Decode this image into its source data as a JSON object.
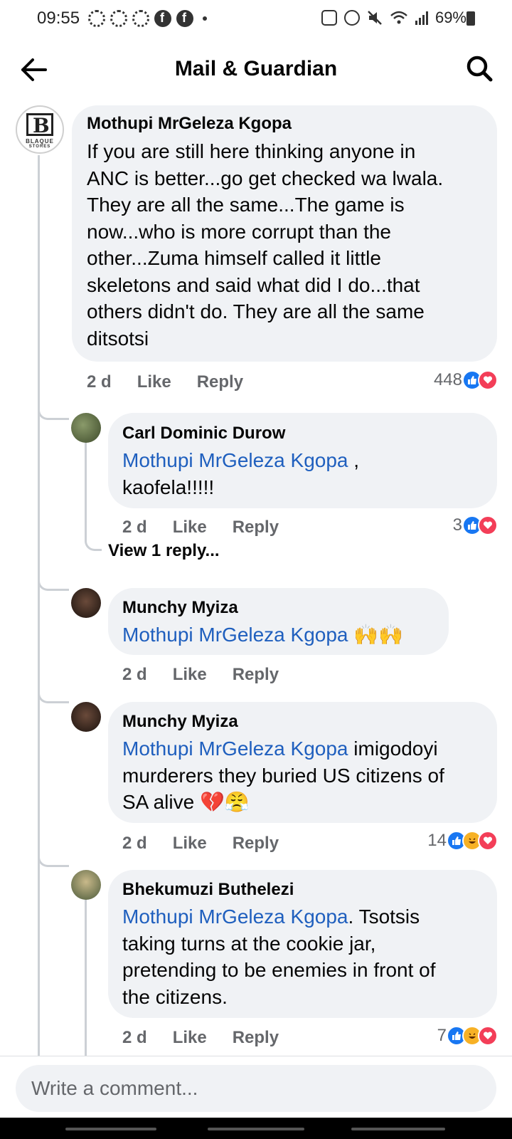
{
  "status_bar": {
    "time": "09:55",
    "battery": "69%"
  },
  "header": {
    "title": "Mail & Guardian",
    "back_icon": "arrow-left-icon",
    "search_icon": "search-icon"
  },
  "comments": [
    {
      "author": "Mothupi MrGeleza Kgopa",
      "avatar_label": "B",
      "avatar_text": "BLAQUE",
      "avatar_subtext": "STORES",
      "lines": [
        "If you are still here thinking anyone in",
        "ANC is better...go get checked wa lwala.",
        "They are all the same...The game is",
        "now...who is more corrupt than the",
        "other...Zuma himself called it little",
        "skeletons and said what did I do...that",
        "others didn't do. They are all the same",
        "ditsotsi"
      ],
      "time": "2 d",
      "like": "Like",
      "reply": "Reply",
      "reaction_count": "448"
    },
    {
      "author": "Carl Dominic Durow",
      "mention": "Mothupi MrGeleza Kgopa",
      "text_after_mention": " ,",
      "line2": "kaofela!!!!!",
      "time": "2 d",
      "like": "Like",
      "reply": "Reply",
      "reaction_count": "3"
    },
    {
      "author": "Munchy Myiza",
      "mention": "Mothupi MrGeleza Kgopa",
      "text_after_mention": " 🙌🙌",
      "time": "2 d",
      "like": "Like",
      "reply": "Reply"
    },
    {
      "author": "Munchy Myiza",
      "mention": "Mothupi MrGeleza Kgopa",
      "text_after_mention": " imigodoyi",
      "line2": "murderers they buried US citizens of",
      "line3": "SA alive 💔😤",
      "time": "2 d",
      "like": "Like",
      "reply": "Reply",
      "reaction_count": "14"
    },
    {
      "author": "Bhekumuzi Buthelezi",
      "mention": "Mothupi MrGeleza Kgopa",
      "text_after_mention": ". Tsotsis",
      "line2": "taking turns at the cookie jar,",
      "line3": "pretending to be enemies in front of",
      "line4": "the citizens.",
      "time": "2 d",
      "like": "Like",
      "reply": "Reply",
      "reaction_count": "7"
    }
  ],
  "view_replies": "View 1 reply...",
  "composer": {
    "placeholder": "Write a comment..."
  },
  "colors": {
    "mention": "#1f5fbe",
    "bubble": "#f0f2f5",
    "like": "#1877f2",
    "love": "#f33e58",
    "haha": "#f7b125"
  }
}
